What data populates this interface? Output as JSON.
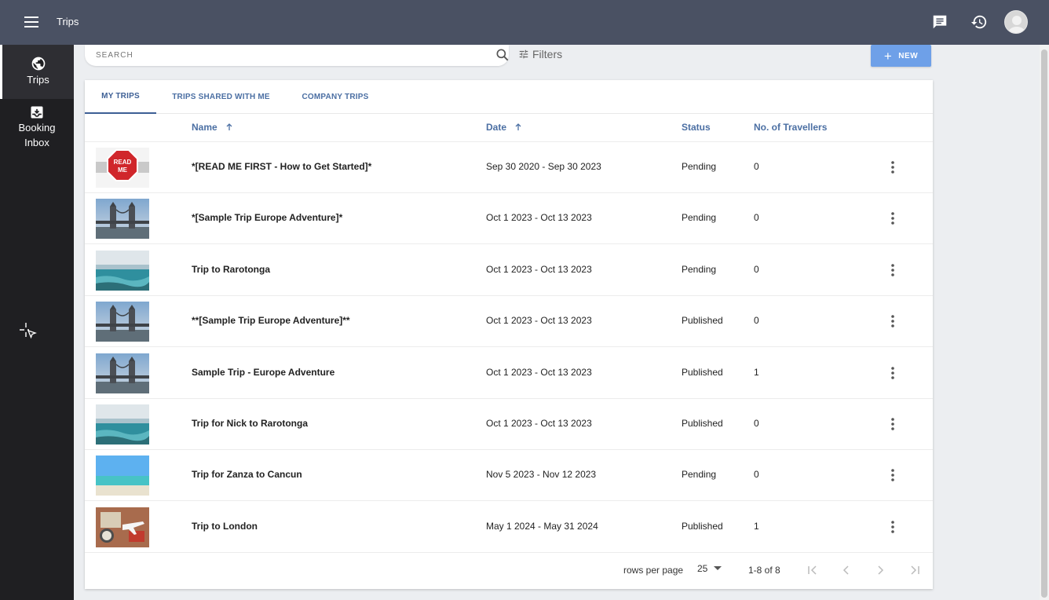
{
  "app": {
    "title": "Trips"
  },
  "topbar": {
    "menu_icon": "hamburger-menu-icon",
    "chat_icon": "chat-icon",
    "history_icon": "history-icon",
    "avatar_icon": "user-avatar"
  },
  "sidebar": {
    "items": [
      {
        "label": "Trips",
        "icon": "globe-icon",
        "active": true
      },
      {
        "label": "Booking\nInbox",
        "label_line1": "Booking",
        "label_line2": "Inbox",
        "icon": "inbox-icon",
        "active": false
      }
    ]
  },
  "search": {
    "placeholder": "SEARCH",
    "value": ""
  },
  "filters": {
    "label": "Filters"
  },
  "new_button": {
    "label": "NEW"
  },
  "tabs": [
    {
      "label": "MY TRIPS",
      "active": true
    },
    {
      "label": "TRIPS SHARED WITH ME",
      "active": false
    },
    {
      "label": "COMPANY TRIPS",
      "active": false
    }
  ],
  "columns": {
    "name": "Name",
    "date": "Date",
    "status": "Status",
    "travellers": "No. of Travellers"
  },
  "rows": [
    {
      "thumb": "readme",
      "name": "*[READ ME FIRST - How to Get Started]*",
      "date": "Sep 30 2020 - Sep 30 2023",
      "status": "Pending",
      "travellers": "0"
    },
    {
      "thumb": "bridge",
      "name": "*[Sample Trip Europe Adventure]*",
      "date": "Oct 1 2023 - Oct 13 2023",
      "status": "Pending",
      "travellers": "0"
    },
    {
      "thumb": "sea",
      "name": "Trip to Rarotonga",
      "date": "Oct 1 2023 - Oct 13 2023",
      "status": "Pending",
      "travellers": "0"
    },
    {
      "thumb": "bridge",
      "name": "**[Sample Trip Europe Adventure]**",
      "date": "Oct 1 2023 - Oct 13 2023",
      "status": "Published",
      "travellers": "0"
    },
    {
      "thumb": "bridge",
      "name": "Sample Trip - Europe Adventure",
      "date": "Oct 1 2023 - Oct 13 2023",
      "status": "Published",
      "travellers": "1"
    },
    {
      "thumb": "sea",
      "name": "Trip for Nick to Rarotonga",
      "date": "Oct 1 2023 - Oct 13 2023",
      "status": "Published",
      "travellers": "0"
    },
    {
      "thumb": "beach",
      "name": "Trip for Zanza to Cancun",
      "date": "Nov 5 2023 - Nov 12 2023",
      "status": "Pending",
      "travellers": "0"
    },
    {
      "thumb": "travel",
      "name": "Trip to London",
      "date": "May 1 2024 - May 31 2024",
      "status": "Published",
      "travellers": "1"
    }
  ],
  "thumb_text": {
    "readme_line1": "READ",
    "readme_line2": "ME"
  },
  "pagination": {
    "rows_per_page_label": "rows per page",
    "rows_per_page": "25",
    "range": "1-8 of 8"
  },
  "colors": {
    "topbar": "#4a5163",
    "sidebar": "#1f1f22",
    "accent": "#4b6fa3",
    "new_button": "#6ea0e8"
  }
}
